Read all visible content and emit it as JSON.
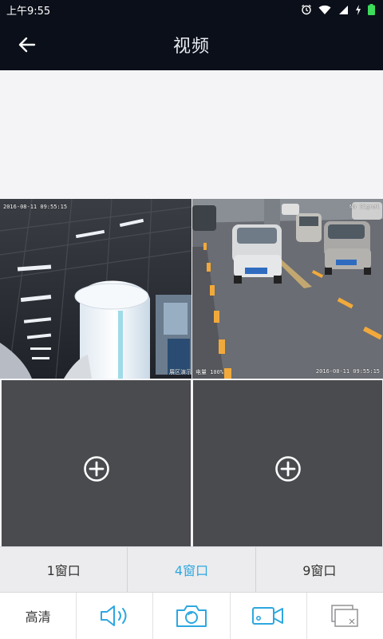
{
  "status_bar": {
    "time": "上午9:55"
  },
  "header": {
    "title": "视频"
  },
  "video_grid": {
    "cells": [
      {
        "osd_top": "2016-08-11 09:55:15",
        "osd_bottom": "展区演示"
      },
      {
        "osd_top_right": "No Signal",
        "osd_bottom_left": "电量 100%",
        "osd_bottom_right": "2016-08-11 09:55:15"
      }
    ]
  },
  "window_modes": {
    "items": [
      "1窗口",
      "4窗口",
      "9窗口"
    ],
    "selected_index": 1
  },
  "toolbar": {
    "quality_label": "高清"
  },
  "colors": {
    "accent": "#2ea7e0",
    "header_bg": "#0b0f19",
    "empty_slot": "#4a4b4f",
    "battery": "#3ddc5a"
  },
  "icons": [
    "alarm-icon",
    "wifi-icon",
    "signal-icon",
    "battery-icon",
    "back-arrow-icon",
    "add-circle-icon",
    "speaker-icon",
    "camera-icon",
    "video-record-icon",
    "close-windows-icon"
  ]
}
